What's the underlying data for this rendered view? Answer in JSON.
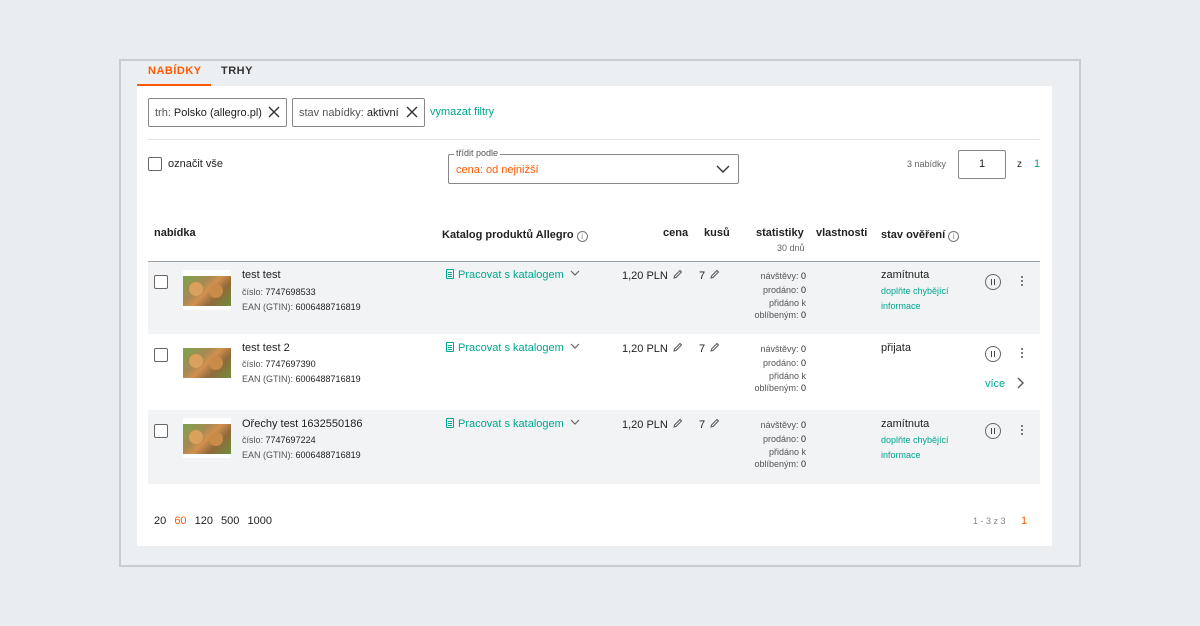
{
  "tabs": [
    {
      "label": "NABÍDKY",
      "active": true
    },
    {
      "label": "TRHY",
      "active": false
    }
  ],
  "filters": {
    "chips": [
      {
        "key": "trh:",
        "value": "Polsko (allegro.pl)"
      },
      {
        "key": "stav nabídky:",
        "value": "aktivní"
      }
    ],
    "clear_label": "vymazat filtry"
  },
  "toolbar": {
    "select_all_label": "označit vše",
    "sort_legend": "třídit podle",
    "sort_value": "cena: od nejnižší",
    "offers_count": "3 nabídky",
    "page_input": "1",
    "page_of": "z",
    "page_total": "1"
  },
  "table": {
    "headers": {
      "offer": "nabídka",
      "catalog": "Katalog produktů Allegro",
      "price": "cena",
      "qty": "kusů",
      "stats": "statistiky",
      "stats_sub": "30 dnů",
      "properties": "vlastnosti",
      "verification": "stav ověření"
    },
    "rows": [
      {
        "title": "test test",
        "number_label": "číslo:",
        "number": "7747698533",
        "ean_label": "EAN (GTIN):",
        "ean": "6006488716819",
        "catalog": "Pracovat s katalogem",
        "price": "1,20 PLN",
        "qty": "7",
        "visits_label": "návštěvy:",
        "visits": "0",
        "sold_label": "prodáno:",
        "sold": "0",
        "fav_label_1": "přidáno k",
        "fav_label_2": "oblíbeným:",
        "fav": "0",
        "status": "zamítnuta",
        "status_link_1": "doplňte chybějící",
        "status_link_2": "informace"
      },
      {
        "title": "test test 2",
        "number_label": "číslo:",
        "number": "7747697390",
        "ean_label": "EAN (GTIN):",
        "ean": "6006488716819",
        "catalog": "Pracovat s katalogem",
        "price": "1,20 PLN",
        "qty": "7",
        "visits_label": "návštěvy:",
        "visits": "0",
        "sold_label": "prodáno:",
        "sold": "0",
        "fav_label_1": "přidáno k",
        "fav_label_2": "oblíbeným:",
        "fav": "0",
        "status": "přijata",
        "more_label": "více"
      },
      {
        "title": "Ořechy test 1632550186",
        "number_label": "číslo:",
        "number": "7747697224",
        "ean_label": "EAN (GTIN):",
        "ean": "6006488716819",
        "catalog": "Pracovat s katalogem",
        "price": "1,20 PLN",
        "qty": "7",
        "visits_label": "návštěvy:",
        "visits": "0",
        "sold_label": "prodáno:",
        "sold": "0",
        "fav_label_1": "přidáno k",
        "fav_label_2": "oblíbeným:",
        "fav": "0",
        "status": "zamítnuta",
        "status_link_1": "doplňte chybějící",
        "status_link_2": "informace"
      }
    ]
  },
  "footer": {
    "page_sizes": [
      "20",
      "60",
      "120",
      "500",
      "1000"
    ],
    "active_page_size": "60",
    "range": "1 - 3 z 3",
    "current_page": "1"
  },
  "colors": {
    "accent": "#ff5a00",
    "link": "#00a790"
  }
}
